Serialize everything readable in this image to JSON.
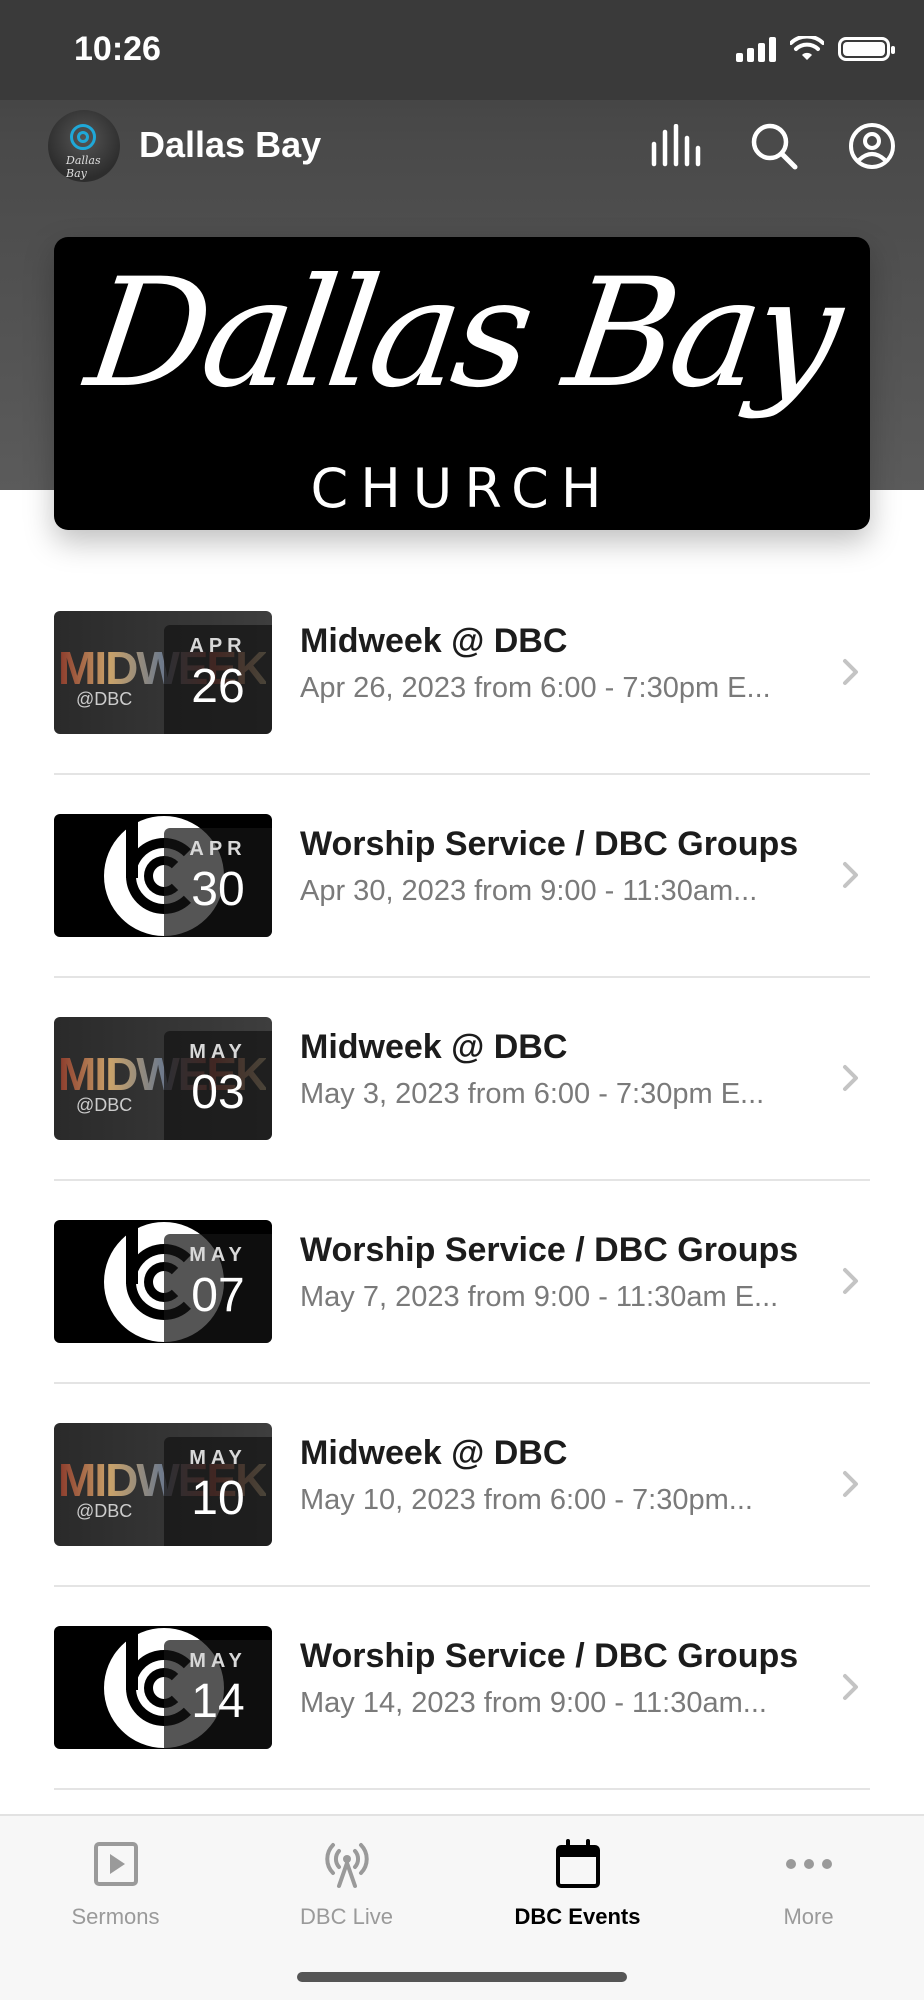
{
  "status_bar": {
    "time": "10:26"
  },
  "app_bar": {
    "title": "Dallas Bay",
    "avatar_text": "Dallas Bay"
  },
  "banner": {
    "script_text": "Dallas Bay",
    "sub_text": "CHURCH"
  },
  "events": [
    {
      "title": "Midweek @ DBC",
      "subtitle": "Apr 26, 2023 from 6:00 - 7:30pm E...",
      "month": "APR",
      "day": "26",
      "thumb": "midweek",
      "thumb_word": "MIDWEEK",
      "thumb_tag": "@DBC"
    },
    {
      "title": "Worship Service / DBC Groups",
      "subtitle": "Apr 30, 2023 from 9:00 - 11:30am...",
      "month": "APR",
      "day": "30",
      "thumb": "worship"
    },
    {
      "title": "Midweek @ DBC",
      "subtitle": "May 3, 2023 from 6:00 - 7:30pm E...",
      "month": "MAY",
      "day": "03",
      "thumb": "midweek",
      "thumb_word": "MIDWEEK",
      "thumb_tag": "@DBC"
    },
    {
      "title": "Worship Service / DBC Groups",
      "subtitle": "May 7, 2023 from 9:00 - 11:30am E...",
      "month": "MAY",
      "day": "07",
      "thumb": "worship"
    },
    {
      "title": "Midweek @ DBC",
      "subtitle": "May 10, 2023 from 6:00 - 7:30pm...",
      "month": "MAY",
      "day": "10",
      "thumb": "midweek",
      "thumb_word": "MIDWEEK",
      "thumb_tag": "@DBC"
    },
    {
      "title": "Worship Service / DBC Groups",
      "subtitle": "May 14, 2023 from 9:00 - 11:30am...",
      "month": "MAY",
      "day": "14",
      "thumb": "worship"
    }
  ],
  "tabs": [
    {
      "label": "Sermons",
      "icon": "play-square-icon",
      "active": false
    },
    {
      "label": "DBC Live",
      "icon": "broadcast-antenna-icon",
      "active": false
    },
    {
      "label": "DBC Events",
      "icon": "calendar-icon",
      "active": true
    },
    {
      "label": "More",
      "icon": "ellipsis-icon",
      "active": false
    }
  ],
  "colors": {
    "header": "#4a4a4a",
    "accent_ring": "#1fa8d8",
    "active_tab": "#000000",
    "inactive_tab": "#9a9a9a"
  }
}
